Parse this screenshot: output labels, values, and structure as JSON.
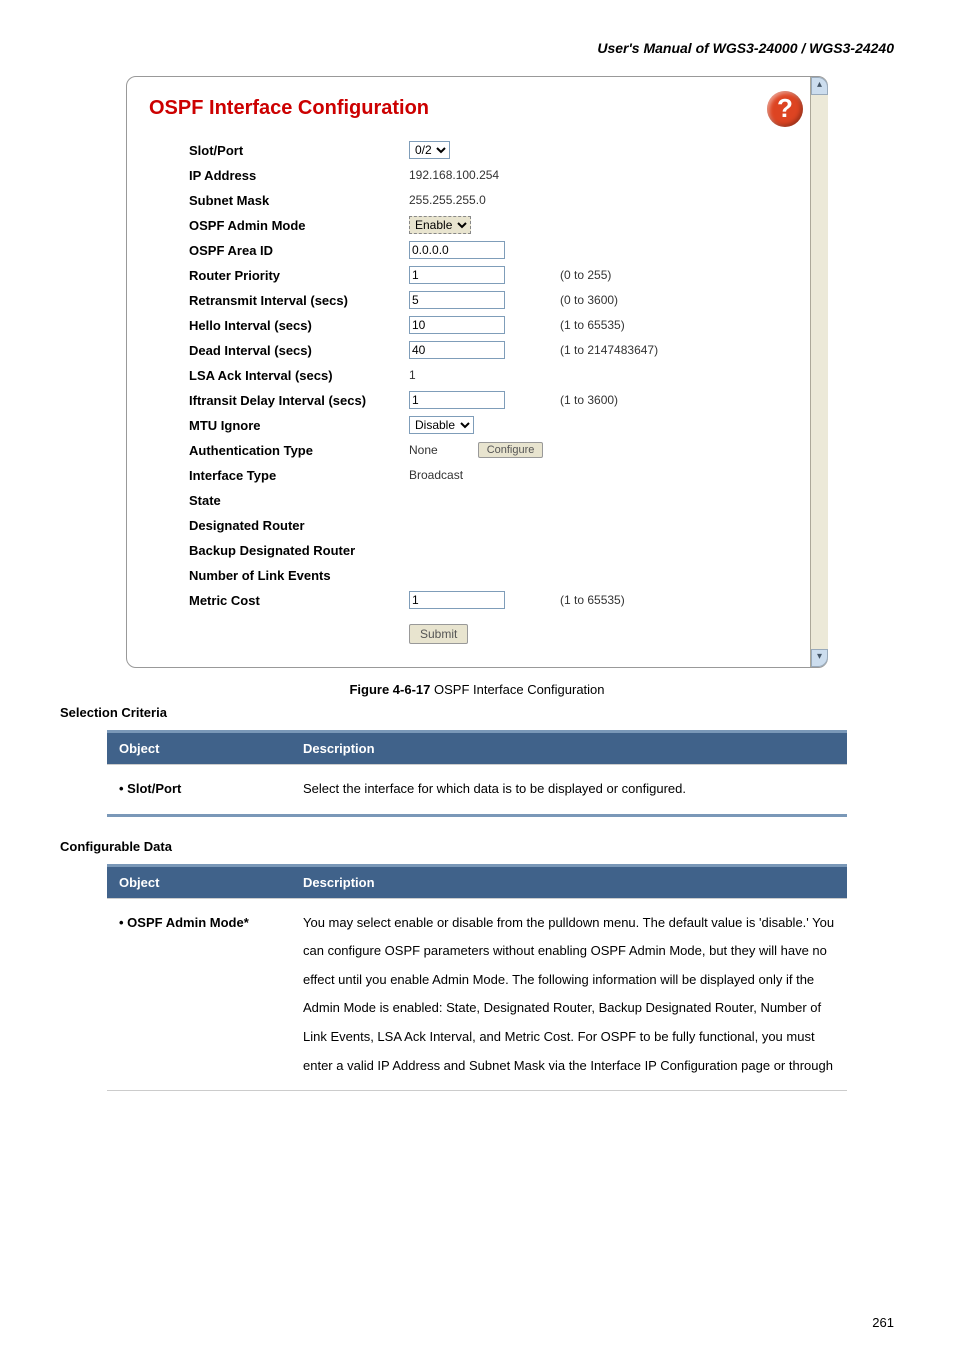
{
  "header": "User's Manual of WGS3-24000 / WGS3-24240",
  "panel": {
    "title": "OSPF Interface Configuration",
    "help": "?",
    "rows": {
      "slot": {
        "label": "Slot/Port",
        "value": "0/2"
      },
      "ip": {
        "label": "IP Address",
        "value": "192.168.100.254"
      },
      "mask": {
        "label": "Subnet Mask",
        "value": "255.255.255.0"
      },
      "admin": {
        "label": "OSPF Admin Mode",
        "value": "Enable"
      },
      "area": {
        "label": "OSPF Area ID",
        "value": "0.0.0.0"
      },
      "rp": {
        "label": "Router Priority",
        "value": "1",
        "range": "(0 to 255)"
      },
      "ri": {
        "label": "Retransmit Interval (secs)",
        "value": "5",
        "range": "(0 to 3600)"
      },
      "hi": {
        "label": "Hello Interval (secs)",
        "value": "10",
        "range": "(1 to 65535)"
      },
      "di": {
        "label": "Dead Interval (secs)",
        "value": "40",
        "range": "(1 to 2147483647)"
      },
      "lsa": {
        "label": "LSA Ack Interval (secs)",
        "value": "1"
      },
      "ift": {
        "label": "Iftransit Delay Interval (secs)",
        "value": "1",
        "range": "(1 to 3600)"
      },
      "mtu": {
        "label": "MTU Ignore",
        "value": "Disable"
      },
      "auth": {
        "label": "Authentication Type",
        "value": "None",
        "btn": "Configure"
      },
      "itype": {
        "label": "Interface Type",
        "value": "Broadcast"
      },
      "state": {
        "label": "State",
        "value": ""
      },
      "dr": {
        "label": "Designated Router",
        "value": ""
      },
      "bdr": {
        "label": "Backup Designated Router",
        "value": ""
      },
      "nle": {
        "label": "Number of Link Events",
        "value": ""
      },
      "mc": {
        "label": "Metric Cost",
        "value": "1",
        "range": "(1 to 65535)"
      }
    },
    "submit": "Submit"
  },
  "caption": {
    "fig": "Figure 4-6-17",
    "text": " OSPF Interface Configuration"
  },
  "sel_criteria": "Selection Criteria",
  "cfg_data": "Configurable Data",
  "th": {
    "obj": "Object",
    "desc": "Description"
  },
  "t1": {
    "obj": "Slot/Port",
    "desc": "Select the interface for which data is to be displayed or configured."
  },
  "t2": {
    "obj": "OSPF Admin Mode*",
    "desc": "You may select enable or disable from the pulldown menu. The default value is 'disable.' You can configure OSPF parameters without enabling OSPF Admin Mode, but they will have no effect until you enable Admin Mode. The following information will be displayed only if the Admin Mode is enabled: State, Designated Router, Backup Designated Router, Number of Link Events, LSA Ack Interval, and Metric Cost. For OSPF to be fully functional, you must enter a valid IP Address and Subnet Mask via the Interface IP Configuration page or through"
  },
  "page": "261"
}
